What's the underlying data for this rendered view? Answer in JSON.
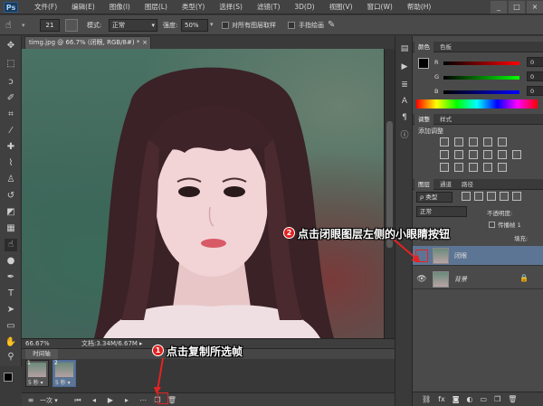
{
  "menubar": {
    "logo": "Ps",
    "items": [
      "文件(F)",
      "编辑(E)",
      "图像(I)",
      "图层(L)",
      "类型(Y)",
      "选择(S)",
      "滤镜(T)",
      "3D(D)",
      "视图(V)",
      "窗口(W)",
      "帮助(H)"
    ],
    "controls": [
      "_",
      "□",
      "×"
    ]
  },
  "options": {
    "brush_size": "21",
    "mode_label": "模式:",
    "mode_value": "正常",
    "strength_label": "强度:",
    "strength_value": "50%",
    "sample_all_label": "对所有图层取样",
    "finger_label": "手指绘画"
  },
  "document": {
    "tab_title": "timg.jpg @ 66.7% (闭眼, RGB/8#) *",
    "zoom": "66.67%",
    "doc_size": "文档:3.34M/6.67M"
  },
  "timeline": {
    "tab": "时间轴",
    "frames": [
      {
        "num": "1",
        "duration": "5 秒 ▾"
      },
      {
        "num": "2",
        "duration": "5 秒 ▾"
      }
    ],
    "loop": "一次"
  },
  "color_panel": {
    "tabs": [
      "颜色",
      "色板"
    ],
    "r_label": "R",
    "r_value": "0",
    "g_label": "G",
    "g_value": "0",
    "b_label": "B",
    "b_value": "0"
  },
  "adjust_panel": {
    "tabs": [
      "调整",
      "样式"
    ],
    "title": "添加调整"
  },
  "layers_panel": {
    "tabs": [
      "图层",
      "通道",
      "路径"
    ],
    "kind": "ρ 类型",
    "blend": "正常",
    "opacity_label": "不透明度:",
    "unify_label": "传播帧 1",
    "fill_label": "填充:",
    "layers": [
      {
        "name": "闭眼",
        "selected": true
      },
      {
        "name": "背景",
        "selected": false
      }
    ]
  },
  "annotations": {
    "step1_badge": "1",
    "step1_text": "点击复制所选帧",
    "step2_badge": "2",
    "step2_text": "点击闭眼图层左侧的小眼睛按钮"
  },
  "colors": {
    "annotation_red": "#e02020",
    "selected_layer": "#5d7594",
    "fg_color": "#000000",
    "bg_color": "#ffffff"
  }
}
